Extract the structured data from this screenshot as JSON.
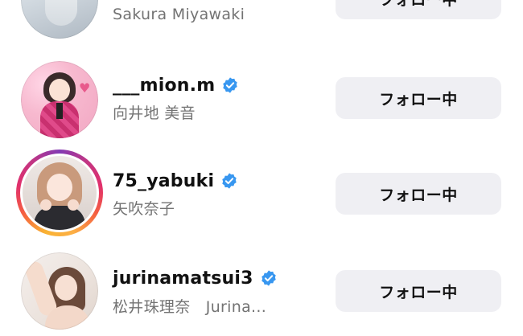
{
  "follow_list": [
    {
      "username": "",
      "full_name": "Sakura Miyawaki",
      "verified": false,
      "has_story_ring": false,
      "button_label": "フォロー中"
    },
    {
      "username": "___mion.m",
      "full_name": "向井地 美音",
      "verified": true,
      "has_story_ring": false,
      "button_label": "フォロー中"
    },
    {
      "username": "75_yabuki",
      "full_name": "矢吹奈子",
      "verified": true,
      "has_story_ring": true,
      "button_label": "フォロー中"
    },
    {
      "username": "jurinamatsui3",
      "full_name": "松井珠理奈　Jurina...",
      "verified": true,
      "has_story_ring": false,
      "button_label": "フォロー中"
    }
  ],
  "colors": {
    "verified_badge": "#3897f0",
    "button_bg": "#efeff3",
    "secondary_text": "#737373",
    "primary_text": "#111111"
  }
}
